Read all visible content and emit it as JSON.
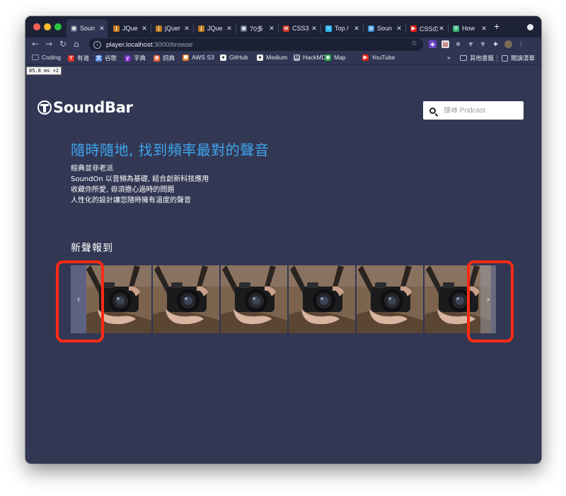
{
  "browser": {
    "tabs": [
      {
        "title": "Soun",
        "icon": "globe-icon",
        "color": "#5f6680",
        "active": true
      },
      {
        "title": "JQue",
        "icon": "jquery-icon",
        "color": "#c07a1a"
      },
      {
        "title": "jQuer",
        "icon": "jquery-icon",
        "color": "#c07a1a"
      },
      {
        "title": "JQue",
        "icon": "jquery-icon",
        "color": "#c07a1a"
      },
      {
        "title": "70多",
        "icon": "globe-icon",
        "color": "#5f6680"
      },
      {
        "title": "CSS3",
        "icon": "w3-icon",
        "color": "#d23a2a"
      },
      {
        "title": "Top /",
        "icon": "tailwind-icon",
        "color": "#38bdf8"
      },
      {
        "title": "Soun",
        "icon": "compass-icon",
        "color": "#3a8fd8"
      },
      {
        "title": "CSSの",
        "icon": "youtube-icon",
        "color": "#e62117"
      },
      {
        "title": "How",
        "icon": "vuetify-icon",
        "color": "#3fb27f"
      }
    ],
    "new_tab": "+",
    "url": {
      "host": "player.localhost",
      "path": ":3000/browse"
    },
    "bookmarks": [
      {
        "label": "Coding",
        "icon": "folder-icon",
        "color": "#8f96b0"
      },
      {
        "label": "有道",
        "icon": "youdao-icon",
        "color": "#e0322b"
      },
      {
        "label": "谷歌",
        "icon": "translate-icon",
        "color": "#4a86e8"
      },
      {
        "label": "字典",
        "icon": "yahoo-icon",
        "color": "#7b2fc9"
      },
      {
        "label": "詞典",
        "icon": "dictionary-icon",
        "color": "#e3613a"
      },
      {
        "label": "AWS S3",
        "icon": "aws-icon",
        "color": "#e8802a"
      },
      {
        "label": "GitHub",
        "icon": "github-icon",
        "color": "#f0f0f0"
      },
      {
        "label": "Medium",
        "icon": "medium-icon",
        "color": "#f0f0f0"
      },
      {
        "label": "HackMD",
        "icon": "hackmd-icon",
        "color": "#b7bccc"
      },
      {
        "label": "Map",
        "icon": "map-pin-icon",
        "color": "#34a853"
      },
      {
        "label": "YouTube",
        "icon": "youtube-icon",
        "color": "#e62117"
      }
    ],
    "bookmarks_more": "»",
    "other_bookmarks": "其他書籤",
    "reading_list": "閱讀清單"
  },
  "perf_badge": "85.8 ms ×2",
  "header": {
    "logo_text": "SoundBar",
    "search_placeholder": "搜尋 Podcast"
  },
  "hero": {
    "headline": "隨時隨地, 找到頻率最對的聲音",
    "lines": [
      "經典並非老派",
      "SoundOn 以音頻為基礎, 結合創新科技應用",
      "收藏你所愛, 毋須擔心過時的問題",
      "人性化的設計讓您隨時擁有溫度的聲音"
    ]
  },
  "new_releases": {
    "title": "新聲報到",
    "card_count": 6,
    "prev_label": "‹",
    "next_label": "›"
  },
  "colors": {
    "page_bg": "#323754",
    "headline": "#3fa6ec",
    "annotation": "#ff2a14"
  }
}
